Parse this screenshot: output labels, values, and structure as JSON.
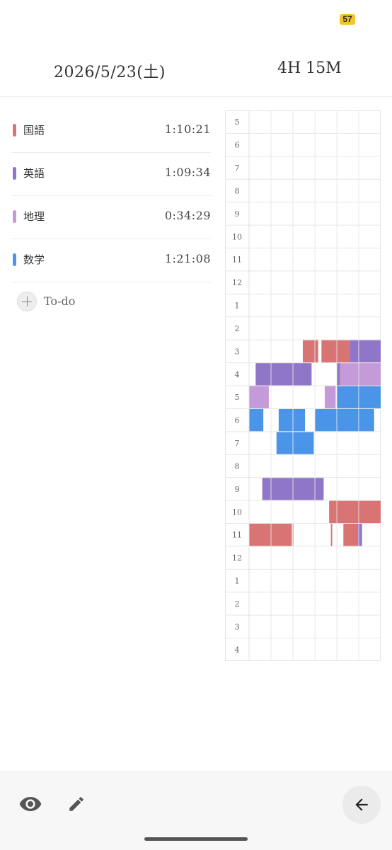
{
  "status_bar": {
    "battery_level": "57"
  },
  "header": {
    "date": "2026/5/23(土)",
    "total_time": "4H 15M"
  },
  "subjects": [
    {
      "name": "国語",
      "time": "1:10:21",
      "color": "#d87473"
    },
    {
      "name": "英語",
      "time": "1:09:34",
      "color": "#8f76c8"
    },
    {
      "name": "地理",
      "time": "0:34:29",
      "color": "#c49ad8"
    },
    {
      "name": "数学",
      "time": "1:21:08",
      "color": "#4a95e8"
    }
  ],
  "todo": {
    "label": "To-do",
    "icon": "plus-icon"
  },
  "timeline": {
    "hour_labels": [
      "5",
      "6",
      "7",
      "8",
      "9",
      "10",
      "11",
      "12",
      "1",
      "2",
      "3",
      "4",
      "5",
      "6",
      "7",
      "8",
      "9",
      "10",
      "11",
      "12",
      "1",
      "2",
      "3",
      "4"
    ],
    "subdivisions_per_hour": 6,
    "blocks": [
      {
        "row": 10,
        "start": 2.45,
        "end": 3.15,
        "subject": 0
      },
      {
        "row": 10,
        "start": 3.3,
        "end": 3.95,
        "subject": 0
      },
      {
        "row": 10,
        "start": 3.95,
        "end": 4.6,
        "subject": 0
      },
      {
        "row": 10,
        "start": 4.6,
        "end": 6.0,
        "subject": 1
      },
      {
        "row": 11,
        "start": 0.3,
        "end": 2.85,
        "subject": 1
      },
      {
        "row": 11,
        "start": 4.0,
        "end": 4.15,
        "subject": 1
      },
      {
        "row": 11,
        "start": 4.15,
        "end": 6.0,
        "subject": 2
      },
      {
        "row": 12,
        "start": 0.0,
        "end": 0.9,
        "subject": 2
      },
      {
        "row": 12,
        "start": 3.45,
        "end": 3.95,
        "subject": 2
      },
      {
        "row": 12,
        "start": 4.0,
        "end": 6.0,
        "subject": 3
      },
      {
        "row": 13,
        "start": 0.0,
        "end": 0.65,
        "subject": 3
      },
      {
        "row": 13,
        "start": 1.35,
        "end": 2.55,
        "subject": 3
      },
      {
        "row": 13,
        "start": 3.0,
        "end": 5.7,
        "subject": 3
      },
      {
        "row": 14,
        "start": 1.25,
        "end": 2.95,
        "subject": 3
      },
      {
        "row": 16,
        "start": 0.6,
        "end": 3.4,
        "subject": 1
      },
      {
        "row": 17,
        "start": 3.65,
        "end": 6.0,
        "subject": 0
      },
      {
        "row": 18,
        "start": 0.0,
        "end": 1.95,
        "subject": 0
      },
      {
        "row": 18,
        "start": 1.98,
        "end": 2.03,
        "subject": 0
      },
      {
        "row": 18,
        "start": 3.73,
        "end": 3.79,
        "subject": 0
      },
      {
        "row": 18,
        "start": 4.3,
        "end": 4.95,
        "subject": 0
      },
      {
        "row": 18,
        "start": 4.95,
        "end": 5.15,
        "subject": 1
      }
    ]
  },
  "bottom_bar": {
    "icons": [
      "eye-icon",
      "pencil-icon",
      "arrow-left-icon"
    ]
  }
}
